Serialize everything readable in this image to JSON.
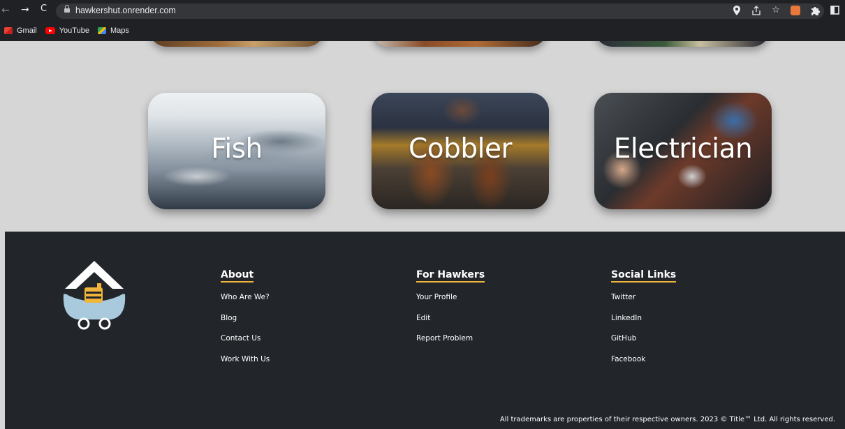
{
  "browser": {
    "url": "hawkershut.onrender.com",
    "bookmarks": [
      {
        "label": "Gmail",
        "icon": "gmail-icon"
      },
      {
        "label": "YouTube",
        "icon": "youtube-icon"
      },
      {
        "label": "Maps",
        "icon": "maps-icon"
      }
    ]
  },
  "categories": [
    {
      "label": "Fish"
    },
    {
      "label": "Cobbler"
    },
    {
      "label": "Electrician"
    }
  ],
  "footer": {
    "about": {
      "title": "About",
      "links": [
        "Who Are We?",
        "Blog",
        "Contact Us",
        "Work With Us"
      ]
    },
    "hawkers": {
      "title": "For Hawkers",
      "links": [
        "Your Profile",
        "Edit",
        "Report Problem"
      ]
    },
    "social": {
      "title": "Social Links",
      "links": [
        "Twitter",
        "LinkedIn",
        "GitHub",
        "Facebook"
      ]
    },
    "copyright": "All trademarks are properties of their respective owners. 2023 © Title™ Ltd. All rights reserved."
  },
  "colors": {
    "footer_bg": "#22262b",
    "accent_underline": "#f0b53a",
    "page_bg": "#d6d6d6"
  }
}
